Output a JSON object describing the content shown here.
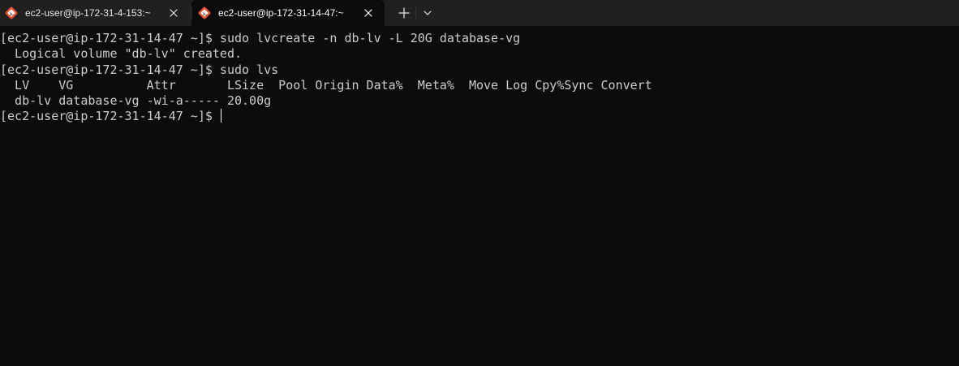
{
  "tabs": [
    {
      "title": "ec2-user@ip-172-31-4-153:~",
      "icon": "git-bash-icon",
      "active": false
    },
    {
      "title": "ec2-user@ip-172-31-14-47:~",
      "icon": "git-bash-icon",
      "active": true
    }
  ],
  "tab_actions": {
    "new_tab_icon": "plus-icon",
    "dropdown_icon": "chevron-down-icon"
  },
  "terminal": {
    "prompt": "[ec2-user@ip-172-31-14-47 ~]$ ",
    "lines": [
      "[ec2-user@ip-172-31-14-47 ~]$ sudo lvcreate -n db-lv -L 20G database-vg",
      "  Logical volume \"db-lv\" created.",
      "[ec2-user@ip-172-31-14-47 ~]$ sudo lvs",
      "  LV    VG          Attr       LSize  Pool Origin Data%  Meta%  Move Log Cpy%Sync Convert",
      "  db-lv database-vg -wi-a----- 20.00g"
    ],
    "colors": {
      "background": "#0c0c0c",
      "foreground": "#cccccc",
      "tabbar": "#202020",
      "cursor": "#ffffff"
    }
  }
}
